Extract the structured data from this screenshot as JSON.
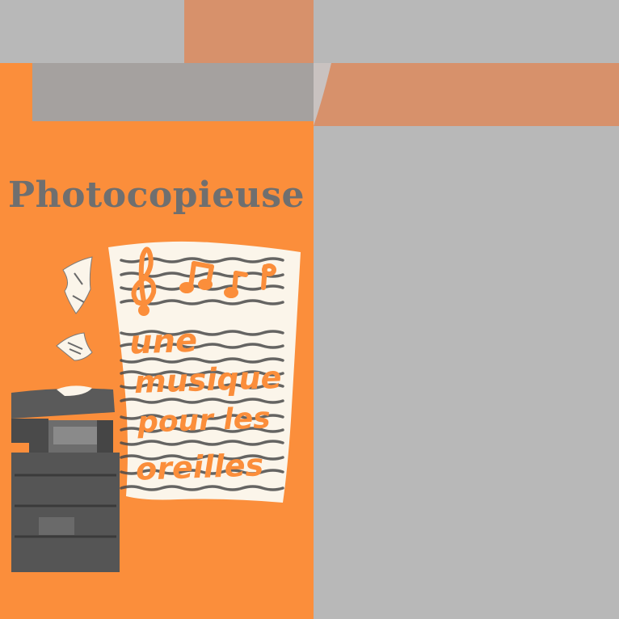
{
  "poster": {
    "title": "Photocopieuse",
    "sheet_lines": [
      "une",
      "musique",
      "pour les",
      "oreilles"
    ]
  },
  "colors": {
    "background": "#b8b8b8",
    "poster_orange": "#fb8e3b",
    "salmon": "#d7916b",
    "gray_panel": "#a5a19f",
    "title_gray": "#6f6f6f",
    "ink_orange": "#fb8e3b",
    "paper": "#fbf5ea",
    "machine_dark": "#4f4f4f"
  },
  "icons": [
    "treble-clef-icon",
    "music-notes-icon",
    "paper-sheet-icon",
    "photocopier-icon"
  ]
}
